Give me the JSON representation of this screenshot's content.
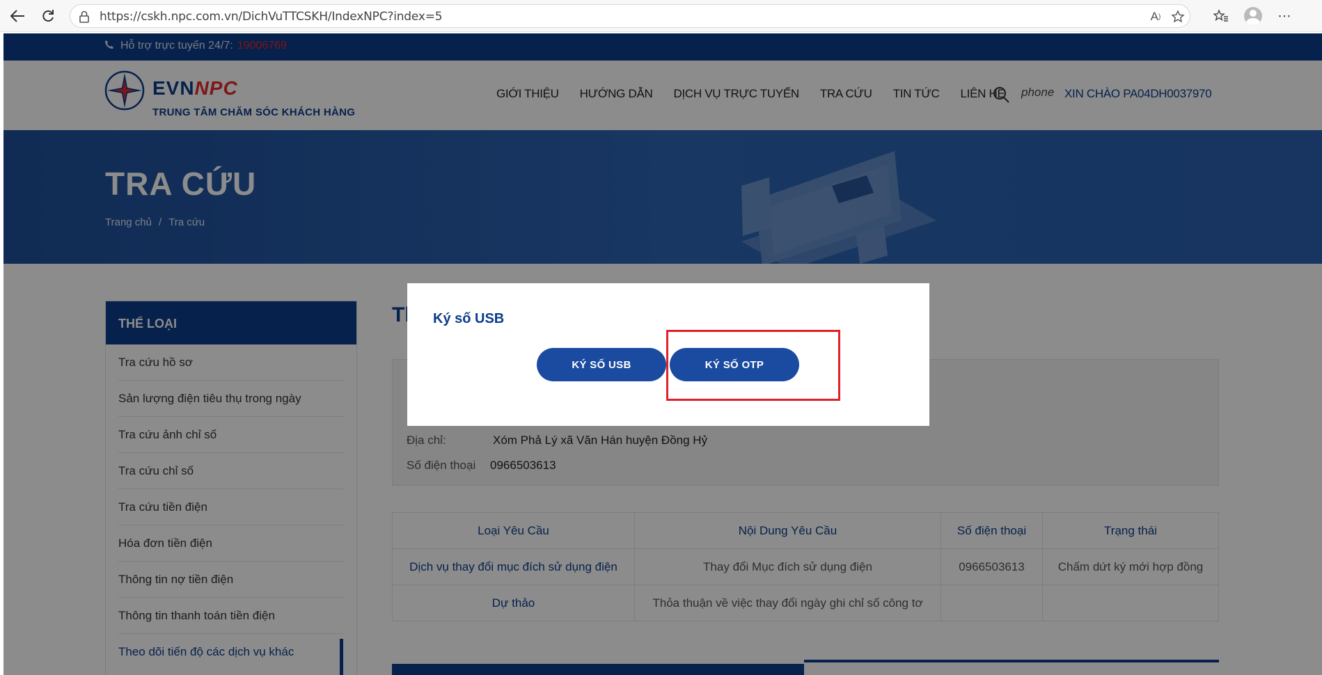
{
  "browser": {
    "url": "https://cskh.npc.com.vn/DichVuTTCSKH/IndexNPC?index=5"
  },
  "topbar": {
    "support_label": "Hỗ trợ trực tuyến 24/7:",
    "support_phone": "19006769"
  },
  "header": {
    "logo_evn": "EVN",
    "logo_npc": "NPC",
    "logo_subtitle": "TRUNG TÂM CHĂM SÓC KHÁCH HÀNG",
    "menu": [
      "GIỚI THIỆU",
      "HƯỚNG DẪN",
      "DỊCH VỤ TRỰC TUYẾN",
      "TRA CỨU",
      "TIN TỨC",
      "LIÊN HỆ"
    ],
    "phone_label": "phone",
    "greeting": "XIN CHÀO PA04DH0037970"
  },
  "banner": {
    "title": "TRA CỨU",
    "breadcrumb_home": "Trang chủ",
    "breadcrumb_sep": "/",
    "breadcrumb_current": "Tra cứu"
  },
  "sidebar": {
    "heading": "THỂ LOẠI",
    "items": [
      "Tra cứu hồ sơ",
      "Sản lượng điện tiêu thụ trong ngày",
      "Tra cứu ảnh chỉ số",
      "Tra cứu chỉ số",
      "Tra cứu tiền điện",
      "Hóa đơn tiền điện",
      "Thông tin nợ tiền điện",
      "Thông tin thanh toán tiền điện",
      "Theo dõi tiến độ các dịch vụ khác"
    ]
  },
  "main": {
    "title_fragment": "Th",
    "address_label": "Địa chỉ:",
    "address_value": "Xóm Phả Lý xã Văn Hán huyện Đồng Hỷ",
    "phone_label": "Số điện thoại",
    "phone_value": "0966503613"
  },
  "table": {
    "headers": [
      "Loại Yêu Cầu",
      "Nội Dung Yêu Cầu",
      "Số điện thoại",
      "Trạng thái"
    ],
    "rows": [
      [
        "Dịch vụ thay đổi mục đích sử dụng điện",
        "Thay đổi Mục đích sử dụng điện",
        "0966503613",
        "Chấm dứt ký mới hợp đồng"
      ],
      [
        "Dự thảo",
        "Thỏa thuận về việc thay đổi ngày ghi chỉ số công tơ",
        "",
        ""
      ]
    ]
  },
  "modal": {
    "title": "Ký số USB",
    "btn_usb": "KÝ SỐ USB",
    "btn_otp": "KÝ SỐ OTP"
  },
  "colors": {
    "primary": "#0b3c8a",
    "accent_red": "#e52a2a",
    "button": "#1b4aa1"
  }
}
